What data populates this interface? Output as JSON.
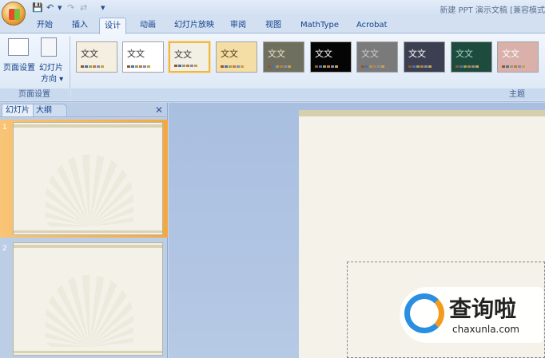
{
  "window": {
    "title": "新建 PPT 演示文稿 [兼容模式"
  },
  "quick_access": {
    "save": "💾",
    "undo": "↶",
    "undo_drop": "▾",
    "redo": "↷",
    "repeat": "⇄",
    "customize": "▾"
  },
  "tabs": [
    {
      "label": "开始"
    },
    {
      "label": "插入"
    },
    {
      "label": "设计",
      "active": true
    },
    {
      "label": "动画"
    },
    {
      "label": "幻灯片放映"
    },
    {
      "label": "审阅"
    },
    {
      "label": "视图"
    },
    {
      "label": "MathType"
    },
    {
      "label": "Acrobat"
    }
  ],
  "ribbon": {
    "page_setup": {
      "page_setup_label": "页面设置",
      "orientation_label_1": "幻灯片",
      "orientation_label_2": "方向 ▾",
      "group_label": "页面设置"
    },
    "themes": {
      "group_label": "主题",
      "sample_text": "文文",
      "items": [
        {
          "bg": "#f4efe0",
          "fg": "#333"
        },
        {
          "bg": "#ffffff",
          "fg": "#333"
        },
        {
          "bg": "#f2efe4",
          "fg": "#333",
          "selected": true
        },
        {
          "bg": "#f5dea6",
          "fg": "#4a3a10"
        },
        {
          "bg": "#6f6f60",
          "fg": "#e8e4c8"
        },
        {
          "bg": "#050505",
          "fg": "#ffffff"
        },
        {
          "bg": "#7a7a7a",
          "fg": "#cfcfcf"
        },
        {
          "bg": "#3c3f52",
          "fg": "#ffffff"
        },
        {
          "bg": "#1d4b3d",
          "fg": "#9fd8c0"
        },
        {
          "bg": "#d9b0aa",
          "fg": "#ffffff"
        }
      ]
    }
  },
  "left_panel": {
    "tab_slides": "幻灯片",
    "tab_outline": "大纲",
    "close": "✕",
    "slides": [
      {
        "number": "1",
        "selected": true
      },
      {
        "number": "2"
      }
    ]
  },
  "watermark": {
    "brand": "查询啦",
    "url": "chaxunla.com"
  }
}
